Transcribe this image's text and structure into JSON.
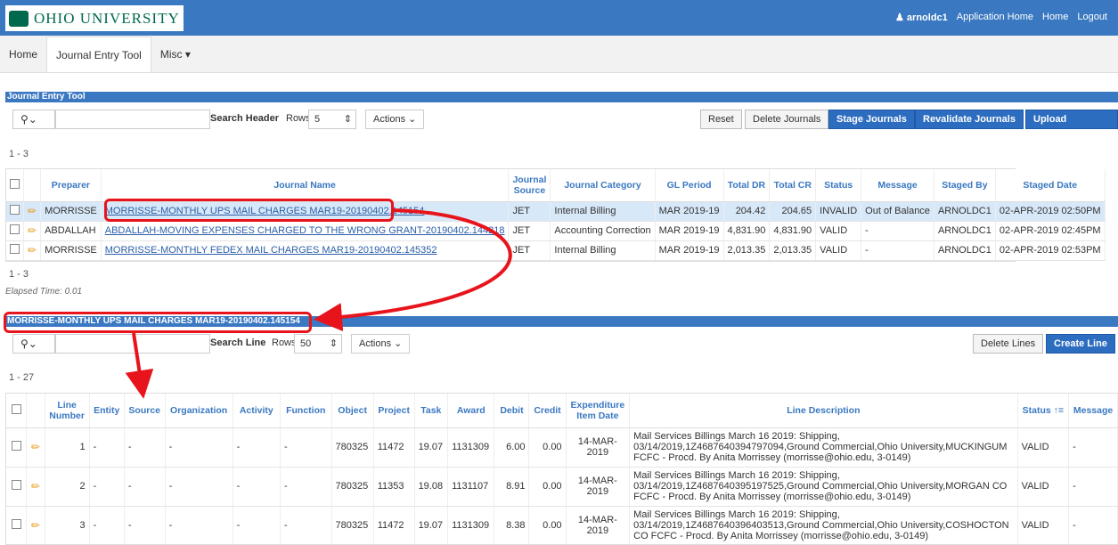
{
  "header": {
    "university": "OHIO UNIVERSITY",
    "user": "arnoldc1",
    "links": [
      "Application Home",
      "Home",
      "Logout"
    ]
  },
  "nav": {
    "tabs": [
      "Home",
      "Journal Entry Tool",
      "Misc"
    ]
  },
  "journal_section": {
    "title": "Journal Entry Tool",
    "search_go": "Search Header",
    "rows_label": "Rows",
    "rows_value": "5",
    "actions": "Actions",
    "buttons": [
      "Reset",
      "Delete Journals",
      "Stage Journals",
      "Revalidate Journals",
      "Upload Journals"
    ],
    "count": "1 - 3",
    "columns": [
      "Preparer",
      "Journal Name",
      "Journal Source",
      "Journal Category",
      "GL Period",
      "Total DR",
      "Total CR",
      "Status",
      "Message",
      "Staged By",
      "Staged Date"
    ],
    "rows": [
      {
        "preparer": "MORRISSE",
        "name": "MORRISSE-MONTHLY UPS MAIL CHARGES MAR19-20190402.145154",
        "source": "JET",
        "category": "Internal Billing",
        "period": "MAR 2019-19",
        "dr": "204.42",
        "cr": "204.65",
        "status": "INVALID",
        "message": "Out of Balance",
        "staged_by": "ARNOLDC1",
        "staged_date": "02-APR-2019 02:50PM"
      },
      {
        "preparer": "ABDALLAH",
        "name": "ABDALLAH-MOVING EXPENSES CHARGED TO THE WRONG GRANT-20190402.144218",
        "source": "JET",
        "category": "Accounting Correction",
        "period": "MAR 2019-19",
        "dr": "4,831.90",
        "cr": "4,831.90",
        "status": "VALID",
        "message": "-",
        "staged_by": "ARNOLDC1",
        "staged_date": "02-APR-2019 02:45PM"
      },
      {
        "preparer": "MORRISSE",
        "name": "MORRISSE-MONTHLY FEDEX MAIL CHARGES MAR19-20190402.145352",
        "source": "JET",
        "category": "Internal Billing",
        "period": "MAR 2019-19",
        "dr": "2,013.35",
        "cr": "2,013.35",
        "status": "VALID",
        "message": "-",
        "staged_by": "ARNOLDC1",
        "staged_date": "02-APR-2019 02:53PM"
      }
    ],
    "count_bottom": "1 - 3",
    "elapsed": "Elapsed Time: 0.01"
  },
  "lines_section": {
    "title": "MORRISSE-MONTHLY UPS MAIL CHARGES MAR19-20190402.145154",
    "search_go": "Search Line",
    "rows_label": "Rows",
    "rows_value": "50",
    "actions": "Actions",
    "buttons": [
      "Delete Lines",
      "Create Line"
    ],
    "count": "1 - 27",
    "columns": [
      "Line Number",
      "Entity",
      "Source",
      "Organization",
      "Activity",
      "Function",
      "Object",
      "Project",
      "Task",
      "Award",
      "Debit",
      "Credit",
      "Expenditure Item Date",
      "Line Description",
      "Status",
      "Message"
    ],
    "rows": [
      {
        "line": "1",
        "entity": "-",
        "source": "-",
        "org": "-",
        "activity": "-",
        "function": "-",
        "object": "780325",
        "project": "11472",
        "task": "19.07",
        "award": "1131309",
        "debit": "6.00",
        "credit": "0.00",
        "date": "14-MAR-2019",
        "desc": "Mail Services Billings March 16 2019: Shipping, 03/14/2019,1Z4687640394797094,Ground Commercial,Ohio University,MUCKINGUM FCFC - Procd. By Anita Morrissey (morrisse@ohio.edu, 3-0149)",
        "status": "VALID",
        "message": "-"
      },
      {
        "line": "2",
        "entity": "-",
        "source": "-",
        "org": "-",
        "activity": "-",
        "function": "-",
        "object": "780325",
        "project": "11353",
        "task": "19.08",
        "award": "1131107",
        "debit": "8.91",
        "credit": "0.00",
        "date": "14-MAR-2019",
        "desc": "Mail Services Billings March 16 2019: Shipping, 03/14/2019,1Z4687640395197525,Ground Commercial,Ohio University,MORGAN CO FCFC - Procd. By Anita Morrissey (morrisse@ohio.edu, 3-0149)",
        "status": "VALID",
        "message": "-"
      },
      {
        "line": "3",
        "entity": "-",
        "source": "-",
        "org": "-",
        "activity": "-",
        "function": "-",
        "object": "780325",
        "project": "11472",
        "task": "19.07",
        "award": "1131309",
        "debit": "8.38",
        "credit": "0.00",
        "date": "14-MAR-2019",
        "desc": "Mail Services Billings March 16 2019: Shipping, 03/14/2019,1Z4687640396403513,Ground Commercial,Ohio University,COSHOCTON CO FCFC - Procd. By Anita Morrissey (morrisse@ohio.edu, 3-0149)",
        "status": "VALID",
        "message": "-"
      }
    ]
  },
  "colors": {
    "accent": "#3a78c1",
    "annotation": "#e8141c",
    "selected_row": "#d7e8f8"
  }
}
